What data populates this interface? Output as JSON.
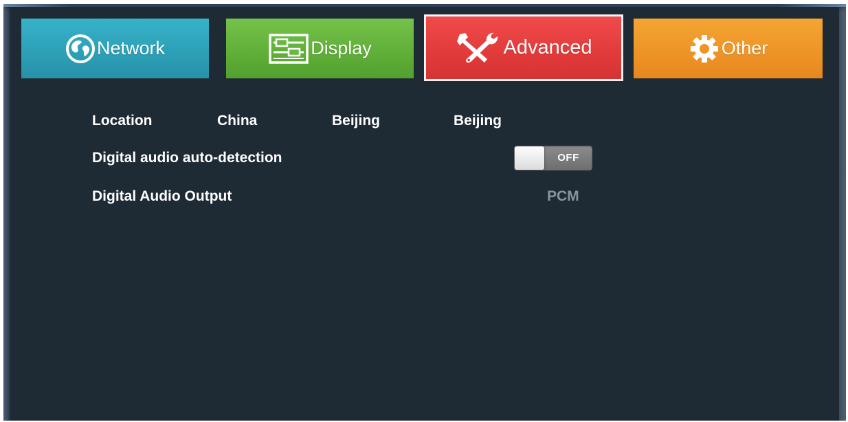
{
  "tabs": {
    "network": {
      "label": "Network",
      "icon": "globe-icon",
      "color": "#2c9fb6"
    },
    "display": {
      "label": "Display",
      "icon": "display-settings-icon",
      "color": "#5fae38"
    },
    "advanced": {
      "label": "Advanced",
      "icon": "tools-icon",
      "color": "#e23a3a",
      "selected": true
    },
    "other": {
      "label": "Other",
      "icon": "gear-icon",
      "color": "#ee9326"
    }
  },
  "settings": {
    "location": {
      "label": "Location",
      "country": "China",
      "province": "Beijing",
      "city": "Beijing"
    },
    "digital_audio_auto_detection": {
      "label": "Digital audio auto-detection",
      "toggle_state": "OFF"
    },
    "digital_audio_output": {
      "label": "Digital Audio Output",
      "value": "PCM"
    }
  }
}
